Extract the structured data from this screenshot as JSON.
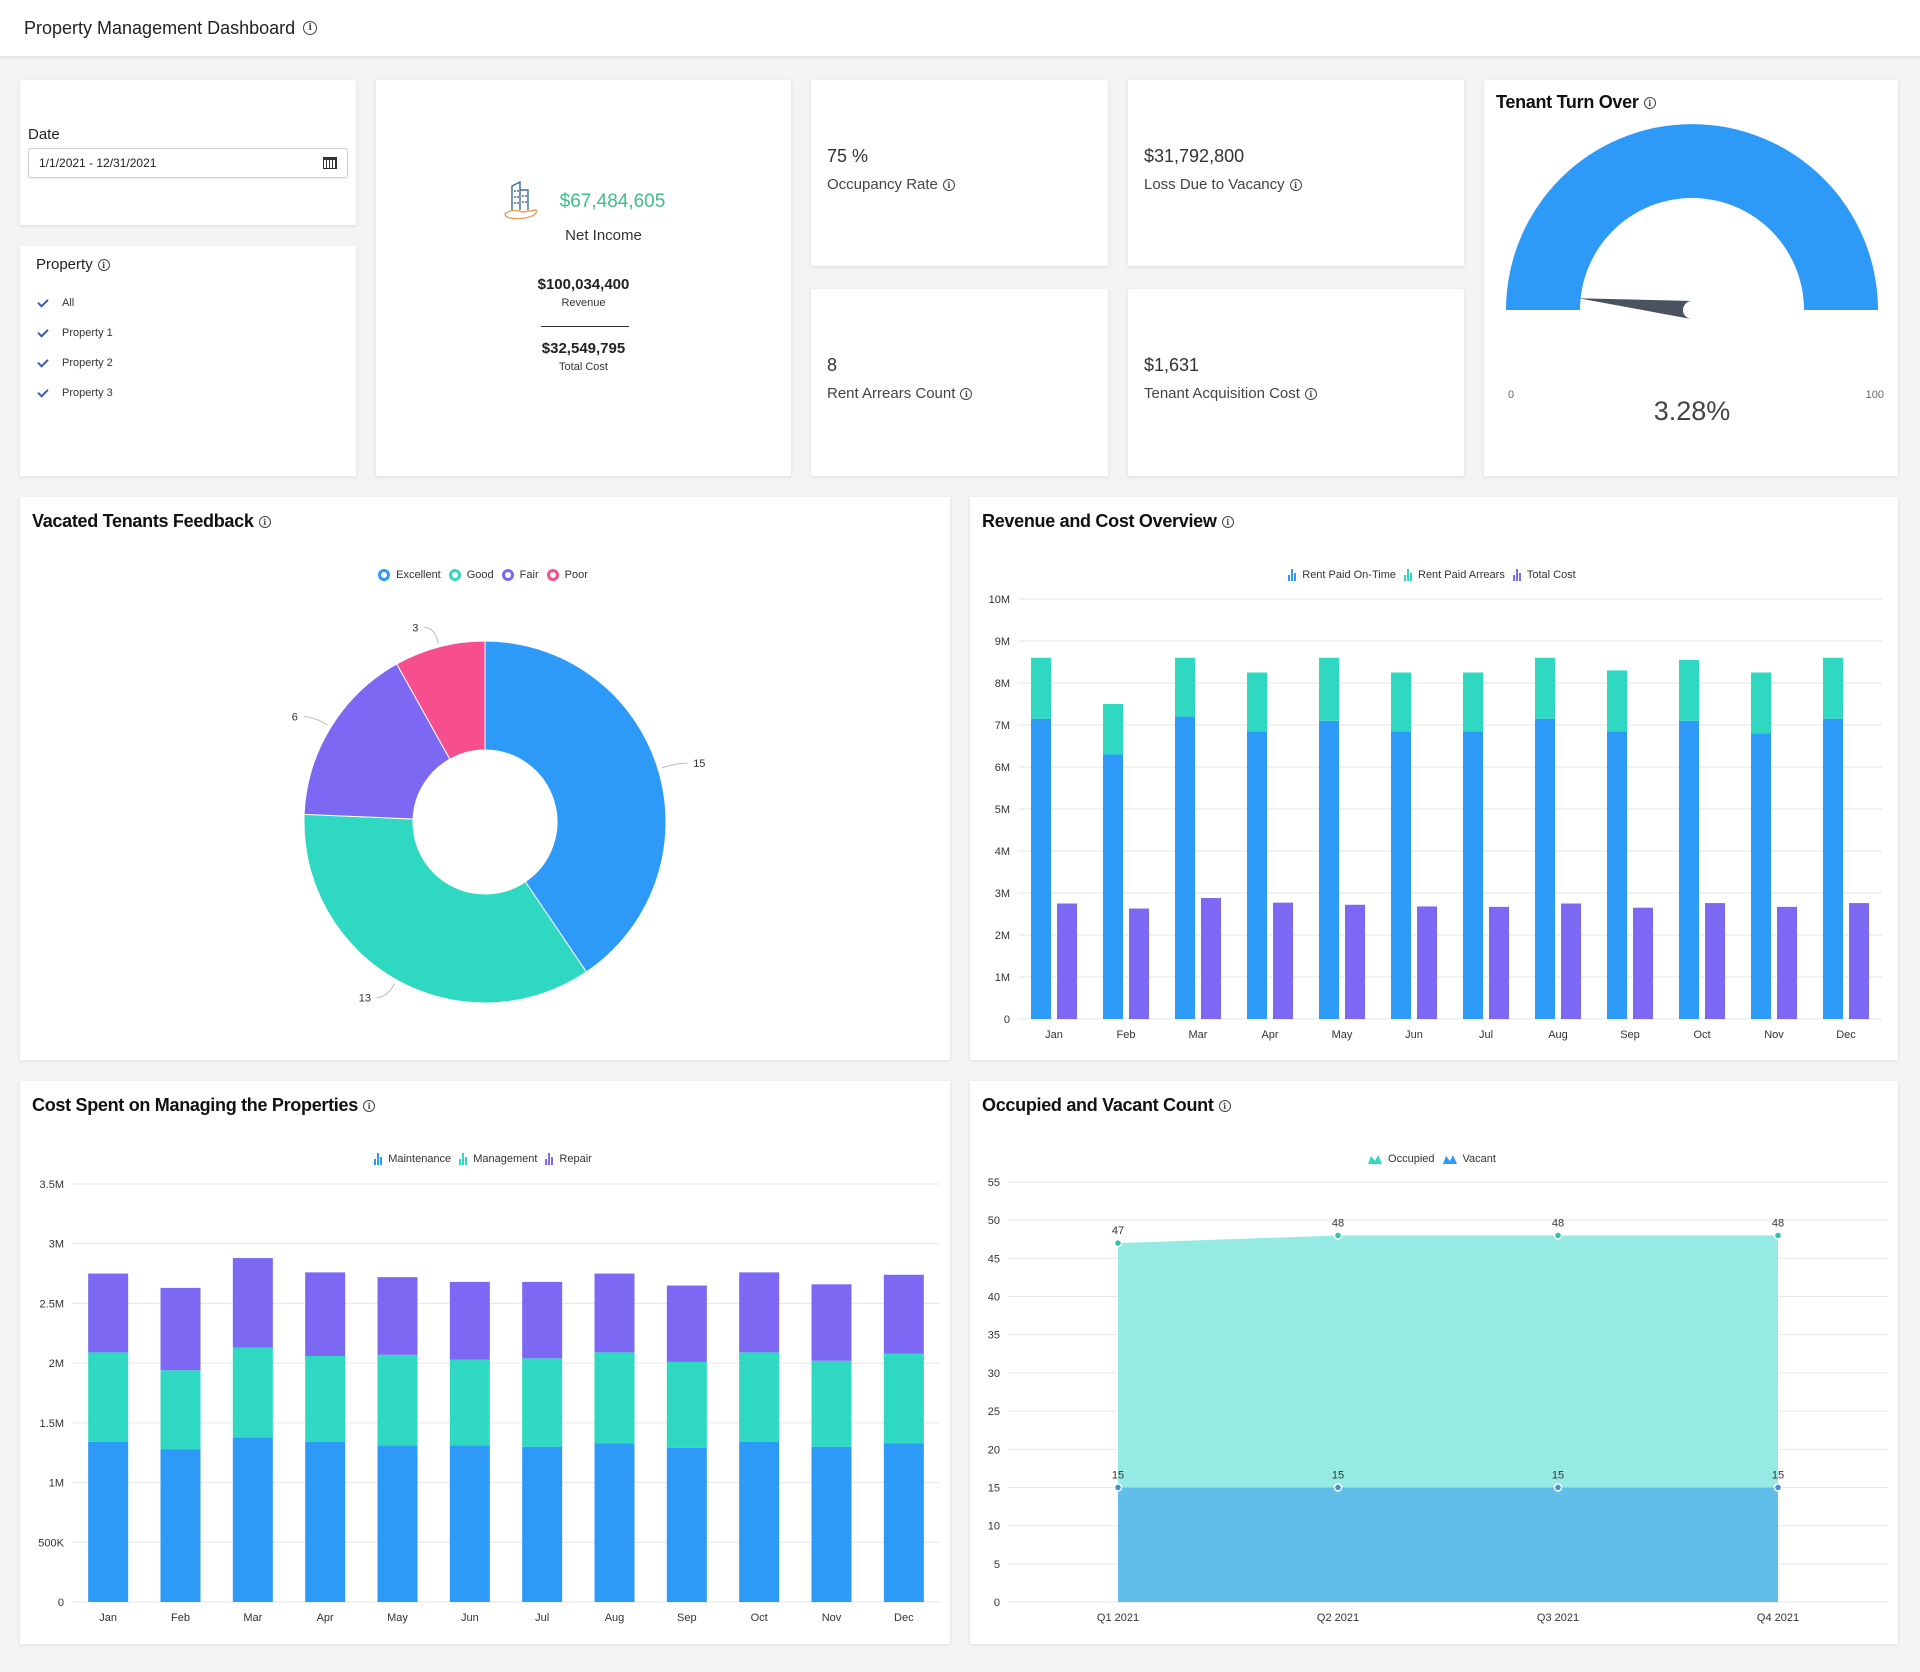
{
  "header": {
    "title": "Property Management Dashboard",
    "info_icon": "info-icon"
  },
  "date_filter": {
    "label": "Date",
    "value": "1/1/2021 - 12/31/2021",
    "icon": "calendar-icon"
  },
  "property_filter": {
    "title": "Property",
    "items": [
      {
        "label": "All",
        "checked": true
      },
      {
        "label": "Property 1",
        "checked": true
      },
      {
        "label": "Property 2",
        "checked": true
      },
      {
        "label": "Property 3",
        "checked": true
      }
    ]
  },
  "net_income": {
    "value": "$67,484,605",
    "label": "Net Income",
    "revenue_value": "$100,034,400",
    "revenue_label": "Revenue",
    "cost_value": "$32,549,795",
    "cost_label": "Total Cost",
    "icon": "building-hand-icon",
    "value_color": "#3dbd88"
  },
  "kpis": [
    {
      "value": "75 %",
      "label": "Occupancy Rate"
    },
    {
      "value": "$31,792,800",
      "label": "Loss Due to Vacancy"
    },
    {
      "value": "8",
      "label": "Rent Arrears Count"
    },
    {
      "value": "$1,631",
      "label": "Tenant Acquisition Cost"
    }
  ],
  "colors": {
    "blue": "#2e9af7",
    "teal": "#2fd9c1",
    "purple": "#7c68f2",
    "pink": "#f74e8d",
    "needle": "#4a5260",
    "vacant_area": "#5fbfea",
    "occupied_area": "#95ebe3"
  },
  "turnover": {
    "title": "Tenant Turn Over",
    "value_text": "3.28%",
    "value": 3.28,
    "min_label": "0",
    "max_label": "100",
    "min": 0,
    "max": 100
  },
  "feedback": {
    "title": "Vacated Tenants Feedback",
    "legend": [
      "Excellent",
      "Good",
      "Fair",
      "Poor"
    ]
  },
  "revenue_cost": {
    "title": "Revenue and Cost Overview",
    "legend": [
      "Rent Paid On-Time",
      "Rent Paid Arrears",
      "Total Cost"
    ]
  },
  "cost_managing": {
    "title": "Cost Spent on Managing the Properties",
    "legend": [
      "Maintenance",
      "Management",
      "Repair"
    ]
  },
  "occupied_vacant": {
    "title": "Occupied and Vacant Count",
    "legend": [
      "Occupied",
      "Vacant"
    ]
  },
  "chart_data": [
    {
      "id": "feedback",
      "type": "pie",
      "title": "Vacated Tenants Feedback",
      "donut": true,
      "categories": [
        "Excellent",
        "Good",
        "Fair",
        "Poor"
      ],
      "values": [
        15,
        13,
        6,
        3
      ],
      "labels": [
        "15",
        "13",
        "6",
        "3"
      ],
      "legend": "top"
    },
    {
      "id": "revenue_cost",
      "type": "bar",
      "title": "Revenue and Cost Overview",
      "categories": [
        "Jan",
        "Feb",
        "Mar",
        "Apr",
        "May",
        "Jun",
        "Jul",
        "Aug",
        "Sep",
        "Oct",
        "Nov",
        "Dec"
      ],
      "series": [
        {
          "name": "Rent Paid On-Time",
          "stack": "rent",
          "values": [
            7150000,
            6300000,
            7200000,
            6850000,
            7100000,
            6850000,
            6850000,
            7150000,
            6850000,
            7100000,
            6800000,
            7150000
          ]
        },
        {
          "name": "Rent Paid Arrears",
          "stack": "rent",
          "values": [
            1450000,
            1200000,
            1400000,
            1400000,
            1500000,
            1400000,
            1400000,
            1450000,
            1450000,
            1450000,
            1450000,
            1450000
          ]
        },
        {
          "name": "Total Cost",
          "stack": "cost",
          "values": [
            2750000,
            2630000,
            2880000,
            2770000,
            2720000,
            2680000,
            2670000,
            2750000,
            2650000,
            2760000,
            2670000,
            2760000
          ]
        }
      ],
      "yticks": [
        "0",
        "1M",
        "2M",
        "3M",
        "4M",
        "5M",
        "6M",
        "7M",
        "8M",
        "9M",
        "10M"
      ],
      "ylim": [
        0,
        10000000
      ],
      "grid": true,
      "legend": "top"
    },
    {
      "id": "cost_managing",
      "type": "bar",
      "stacked": true,
      "title": "Cost Spent on Managing the Properties",
      "categories": [
        "Jan",
        "Feb",
        "Mar",
        "Apr",
        "May",
        "Jun",
        "Jul",
        "Aug",
        "Sep",
        "Oct",
        "Nov",
        "Dec"
      ],
      "series": [
        {
          "name": "Maintenance",
          "values": [
            1340000,
            1280000,
            1380000,
            1340000,
            1310000,
            1310000,
            1300000,
            1330000,
            1290000,
            1340000,
            1300000,
            1330000
          ]
        },
        {
          "name": "Management",
          "values": [
            750000,
            660000,
            750000,
            720000,
            760000,
            720000,
            740000,
            760000,
            720000,
            750000,
            720000,
            750000
          ]
        },
        {
          "name": "Repair",
          "values": [
            660000,
            690000,
            750000,
            700000,
            650000,
            650000,
            640000,
            660000,
            640000,
            670000,
            640000,
            660000
          ]
        }
      ],
      "yticks": [
        "0",
        "500K",
        "1M",
        "1.5M",
        "2M",
        "2.5M",
        "3M",
        "3.5M"
      ],
      "ylim": [
        0,
        3500000
      ],
      "grid": true,
      "legend": "top"
    },
    {
      "id": "occupied_vacant",
      "type": "area",
      "title": "Occupied and Vacant Count",
      "categories": [
        "Q1 2021",
        "Q2 2021",
        "Q3 2021",
        "Q4 2021"
      ],
      "series": [
        {
          "name": "Occupied",
          "values": [
            47,
            48,
            48,
            48
          ]
        },
        {
          "name": "Vacant",
          "values": [
            15,
            15,
            15,
            15
          ]
        }
      ],
      "yticks": [
        "0",
        "5",
        "10",
        "15",
        "20",
        "25",
        "30",
        "35",
        "40",
        "45",
        "50",
        "55"
      ],
      "ylim": [
        0,
        55
      ],
      "grid": true,
      "legend": "top"
    }
  ]
}
